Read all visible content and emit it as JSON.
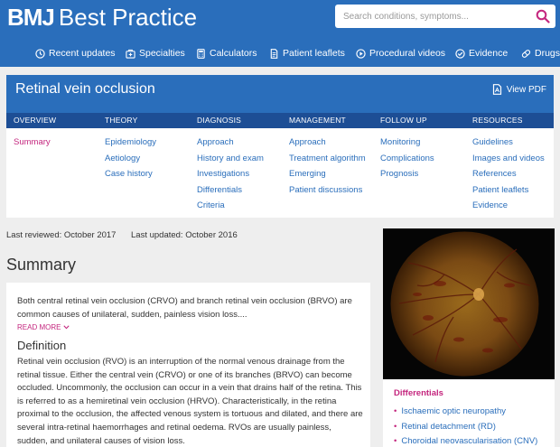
{
  "header": {
    "logo_bold": "BMJ",
    "logo_text": "Best Practice",
    "search_placeholder": "Search conditions, symptoms...",
    "nav": [
      {
        "label": "Recent updates",
        "icon": "clock-icon"
      },
      {
        "label": "Specialties",
        "icon": "medical-bag-icon"
      },
      {
        "label": "Calculators",
        "icon": "calculator-icon"
      },
      {
        "label": "Patient leaflets",
        "icon": "document-icon"
      },
      {
        "label": "Procedural videos",
        "icon": "play-icon"
      },
      {
        "label": "Evidence",
        "icon": "check-circle-icon"
      },
      {
        "label": "Drugs",
        "icon": "pill-icon"
      }
    ]
  },
  "topic": {
    "title": "Retinal vein occlusion",
    "view_pdf": "View PDF",
    "tabs": [
      "Overview",
      "Theory",
      "Diagnosis",
      "Management",
      "Follow up",
      "Resources"
    ],
    "columns": [
      [
        "Summary"
      ],
      [
        "Epidemiology",
        "Aetiology",
        "Case history"
      ],
      [
        "Approach",
        "History and exam",
        "Investigations",
        "Differentials",
        "Criteria"
      ],
      [
        "Approach",
        "Treatment algorithm",
        "Emerging",
        "Patient discussions"
      ],
      [
        "Monitoring",
        "Complications",
        "Prognosis"
      ],
      [
        "Guidelines",
        "Images and videos",
        "References",
        "Patient leaflets",
        "Evidence"
      ]
    ],
    "active": "Summary"
  },
  "dates": {
    "reviewed": "Last reviewed: October 2017",
    "updated": "Last updated: October  2016"
  },
  "summary": {
    "heading": "Summary",
    "intro": "Both central retinal vein occlusion (CRVO) and branch retinal vein occlusion (BRVO) are common causes of unilateral, sudden, painless vision loss....",
    "read_more": "Read more",
    "definition_heading": "Definition",
    "definition_body": "Retinal vein occlusion (RVO) is an interruption of the normal venous drainage from the retinal tissue. Either the central vein (CRVO) or one of its branches (BRVO) can become occluded. Uncommonly, the occlusion can occur in a vein that drains half of the retina. This is referred to as a hemiretinal vein occlusion (HRVO). Characteristically, in the retina proximal to the occlusion, the affected venous system is tortuous and dilated, and there are several intra-retinal haemorrhages and retinal oedema. RVOs are usually painless, sudden, and unilateral causes of vision loss."
  },
  "sidebar": {
    "differentials_heading": "Differentials",
    "differentials": [
      "Ischaemic optic neuropathy",
      "Retinal detachment (RD)",
      "Choroidal neovascularisation (CNV)"
    ]
  },
  "colors": {
    "brand_blue": "#2a6ebb",
    "tab_blue": "#1d4e95",
    "accent_magenta": "#c4267e",
    "page_bg": "#eeeeee"
  }
}
